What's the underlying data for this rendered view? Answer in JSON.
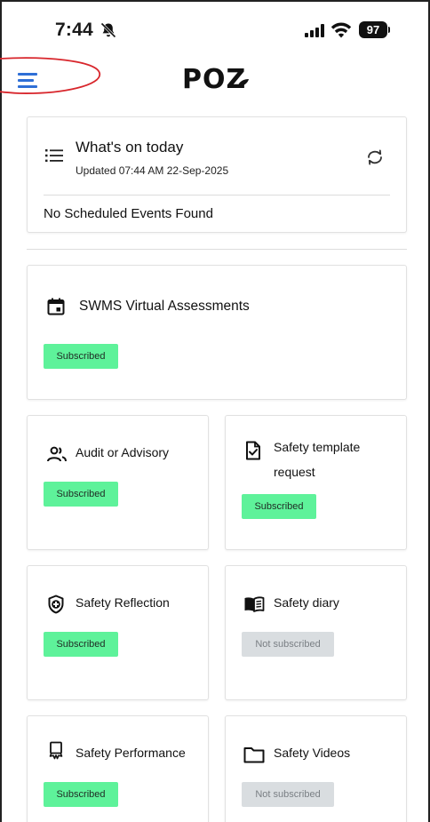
{
  "status_bar": {
    "time": "7:44",
    "battery": "97"
  },
  "header": {
    "brand": "POZ"
  },
  "today": {
    "title": "What's on today",
    "updated": "Updated 07:44 AM 22-Sep-2025",
    "empty_message": "No Scheduled Events Found"
  },
  "services": {
    "swms": {
      "title": "SWMS Virtual Assessments",
      "status": "Subscribed"
    },
    "audit": {
      "title": "Audit or Advisory",
      "status": "Subscribed"
    },
    "template_request": {
      "title_line1": "Safety template",
      "title_line2": "request",
      "status": "Subscribed"
    },
    "reflection": {
      "title": "Safety Reflection",
      "status": "Subscribed"
    },
    "diary": {
      "title": "Safety diary",
      "status": "Not subscribed"
    },
    "performance": {
      "title": "Safety Performance",
      "status": "Subscribed"
    },
    "videos": {
      "title": "Safety Videos",
      "status": "Not subscribed"
    }
  },
  "colors": {
    "subscribed_badge": "#5ef29a",
    "not_subscribed_badge": "#d9dde0",
    "menu_accent": "#2f6fd6",
    "annotation_red": "#d8262c"
  },
  "icons": {
    "status": [
      "bell-slash-icon",
      "signal-icon",
      "wifi-icon",
      "battery-icon"
    ],
    "header": [
      "menu-icon",
      "poz-logo"
    ],
    "today": [
      "list-icon",
      "refresh-icon"
    ],
    "services": [
      "calendar-icon",
      "people-icon",
      "document-check-icon",
      "shield-plus-icon",
      "open-book-icon",
      "award-icon",
      "folder-icon"
    ]
  }
}
